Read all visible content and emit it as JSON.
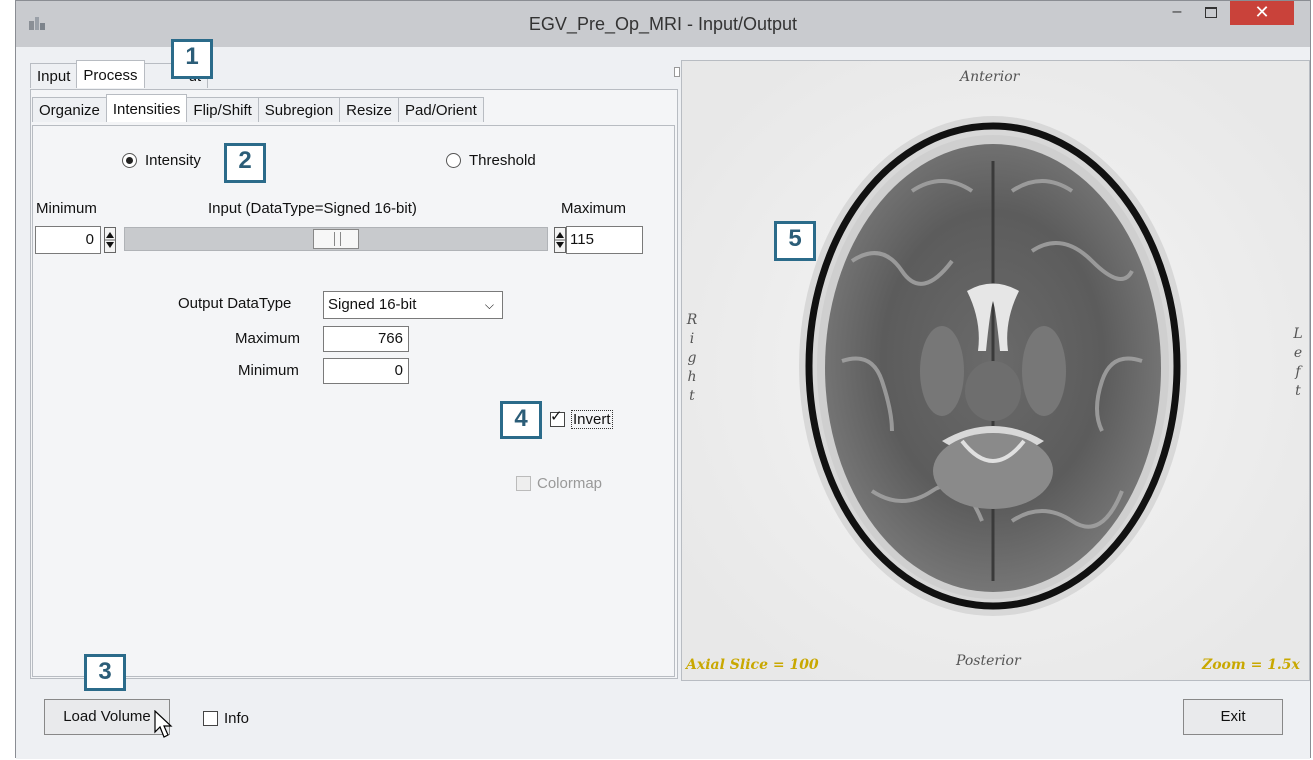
{
  "window": {
    "title": "EGV_Pre_Op_MRI - Input/Output",
    "minimize_glyph": "–",
    "close_glyph": "✕"
  },
  "main_tabs": [
    {
      "label": "Input",
      "active": false
    },
    {
      "label": "Process",
      "active": true
    },
    {
      "label": "ut",
      "active": false
    }
  ],
  "process_tabs": [
    {
      "label": "Organize",
      "active": false
    },
    {
      "label": "Intensities",
      "active": true
    },
    {
      "label": "Flip/Shift",
      "active": false
    },
    {
      "label": "Subregion",
      "active": false
    },
    {
      "label": "Resize",
      "active": false
    },
    {
      "label": "Pad/Orient",
      "active": false
    }
  ],
  "intensities": {
    "mode_intensity_label": "Intensity",
    "mode_threshold_label": "Threshold",
    "selected_mode": "Intensity",
    "minimum_label": "Minimum",
    "input_label": "Input (DataType=Signed 16-bit)",
    "maximum_label": "Maximum",
    "min_value": "0",
    "max_value": "115",
    "output_datatype_label": "Output DataType",
    "output_datatype_value": "Signed 16-bit",
    "out_maximum_label": "Maximum",
    "out_maximum_value": "766",
    "out_minimum_label": "Minimum",
    "out_minimum_value": "0",
    "invert_label": "Invert",
    "invert_checked": true,
    "colormap_label": "Colormap",
    "colormap_enabled": false
  },
  "viewer": {
    "anterior": "Anterior",
    "posterior": "Posterior",
    "right_letters": [
      "R",
      "i",
      "g",
      "h",
      "t"
    ],
    "left_letters": [
      "L",
      "e",
      "f",
      "t"
    ],
    "slice_label": "Axial Slice = 100",
    "zoom_label": "Zoom = 1.5x"
  },
  "bottom": {
    "load_volume": "Load Volume",
    "info_label": "Info",
    "exit": "Exit"
  },
  "callouts": [
    "1",
    "2",
    "3",
    "4",
    "5"
  ],
  "colors": {
    "callout_border": "#2b6b8a",
    "close_button": "#c9423a",
    "overlay_text": "#c9a800"
  }
}
